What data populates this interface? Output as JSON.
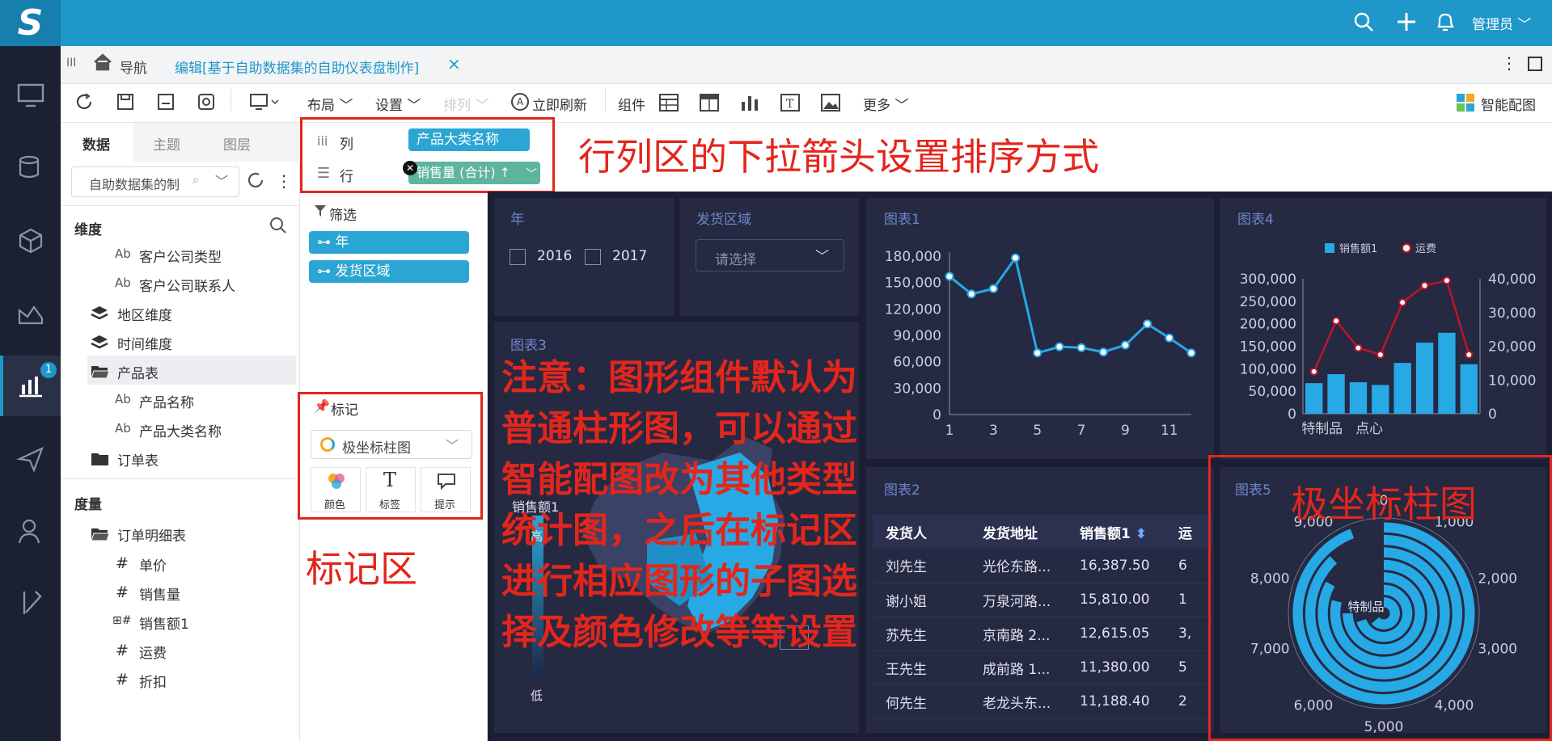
{
  "topbar": {
    "logo": "S",
    "user": "管理员"
  },
  "tabbar": {
    "nav_label": "导航",
    "tab_title": "编辑[基于自助数据集的自助仪表盘制作]",
    "close": "×"
  },
  "toolbar": {
    "layout": "布局",
    "settings": "设置",
    "sort": "排列",
    "refresh_now": "立即刷新",
    "component": "组件",
    "more": "更多",
    "smart": "智能配图"
  },
  "datapanel": {
    "tabs": [
      "数据",
      "主题",
      "图层"
    ],
    "dataset_placeholder": "自助数据集的制",
    "dim_title": "维度",
    "dims": [
      {
        "icon": "Ab",
        "label": "客户公司类型"
      },
      {
        "icon": "Ab",
        "label": "客户公司联系人"
      },
      {
        "icon": "layers",
        "label": "地区维度"
      },
      {
        "icon": "layers",
        "label": "时间维度"
      },
      {
        "icon": "folder",
        "label": "产品表"
      },
      {
        "icon": "Ab",
        "label": "产品名称"
      },
      {
        "icon": "Ab",
        "label": "产品大类名称"
      },
      {
        "icon": "folder",
        "label": "订单表"
      }
    ],
    "measure_title": "度量",
    "measures": [
      {
        "icon": "folder",
        "label": "订单明细表"
      },
      {
        "icon": "#",
        "label": "单价"
      },
      {
        "icon": "#",
        "label": "销售量"
      },
      {
        "icon": "#",
        "label": "销售额1"
      },
      {
        "icon": "#",
        "label": "运费"
      },
      {
        "icon": "#",
        "label": "折扣"
      }
    ]
  },
  "rowcol": {
    "col_label": "列",
    "row_label": "行",
    "col_field": "产品大类名称",
    "row_field": "销售量 (合计) ↑"
  },
  "filter": {
    "title": "筛选",
    "items": [
      "年",
      "发货区域"
    ]
  },
  "mark": {
    "title": "标记",
    "type": "极坐标柱图",
    "buttons": [
      "颜色",
      "标签",
      "提示"
    ]
  },
  "annotations": {
    "rowcol": "行列区的下拉箭头设置排序方式",
    "note": "注意：图形组件默认为普通柱形图，可以通过智能配图改为其他类型统计图，之后在标记区进行相应图形的子图选择及颜色修改等等设置",
    "markzone": "标记区",
    "polar": "极坐标柱图"
  },
  "year_filter": {
    "title": "年",
    "options": [
      "2016",
      "2017"
    ]
  },
  "region_filter": {
    "title": "发货区域",
    "placeholder": "请选择"
  },
  "chart3": {
    "title": "图表3",
    "legend_label": "销售额1",
    "high": "高",
    "low": "低"
  },
  "chart_data": [
    {
      "title": "图表1",
      "type": "line",
      "x": [
        1,
        2,
        3,
        4,
        5,
        6,
        7,
        8,
        9,
        10,
        11,
        12
      ],
      "values": [
        157000,
        137000,
        143000,
        178000,
        70000,
        77000,
        76000,
        71000,
        79000,
        103000,
        87000,
        70000
      ],
      "ylim": [
        0,
        180000
      ],
      "yticks": [
        "180,000",
        "150,000",
        "120,000",
        "90,000",
        "60,000",
        "30,000",
        "0"
      ],
      "xticks": [
        "1",
        "3",
        "5",
        "7",
        "9",
        "11"
      ]
    },
    {
      "title": "图表4",
      "type": "bar",
      "categories": [
        "特制品",
        "",
        "点心",
        "",
        "",
        "",
        "",
        ""
      ],
      "series": [
        {
          "name": "销售额1",
          "type": "bar",
          "values": [
            68000,
            88000,
            70000,
            64000,
            113000,
            158000,
            180000,
            110000
          ]
        },
        {
          "name": "运费",
          "type": "line",
          "values": [
            12500,
            27500,
            19500,
            17500,
            33000,
            38000,
            39500,
            17500
          ]
        }
      ],
      "ylim": [
        0,
        300000
      ],
      "y2lim": [
        0,
        40000
      ],
      "yticks": [
        "300,000",
        "250,000",
        "200,000",
        "150,000",
        "100,000",
        "50,000",
        "0"
      ],
      "y2ticks": [
        "40,000",
        "30,000",
        "20,000",
        "10,000",
        "0"
      ],
      "xticks": [
        "特制品",
        "点心"
      ]
    },
    {
      "title": "图表5",
      "type": "bar",
      "polar": true,
      "categories": [
        "特制品"
      ],
      "values": [
        9400,
        8800,
        8300,
        7900,
        7500,
        7000,
        6400
      ],
      "angle_ticks": [
        "0",
        "1,000",
        "2,000",
        "3,000",
        "4,000",
        "5,000",
        "6,000",
        "7,000",
        "8,000",
        "9,000"
      ]
    }
  ],
  "chart2": {
    "title": "图表2",
    "columns": [
      "发货人",
      "发货地址",
      "销售额1",
      "运"
    ],
    "rows": [
      [
        "刘先生",
        "光伦东路...",
        "16,387.50",
        "6"
      ],
      [
        "谢小姐",
        "万泉河路...",
        "15,810.00",
        "1"
      ],
      [
        "苏先生",
        "京南路 2...",
        "12,615.05",
        "3,"
      ],
      [
        "王先生",
        "成前路 1...",
        "11,380.00",
        "5"
      ],
      [
        "何先生",
        "老龙头东...",
        "11,188.40",
        "2"
      ]
    ]
  }
}
